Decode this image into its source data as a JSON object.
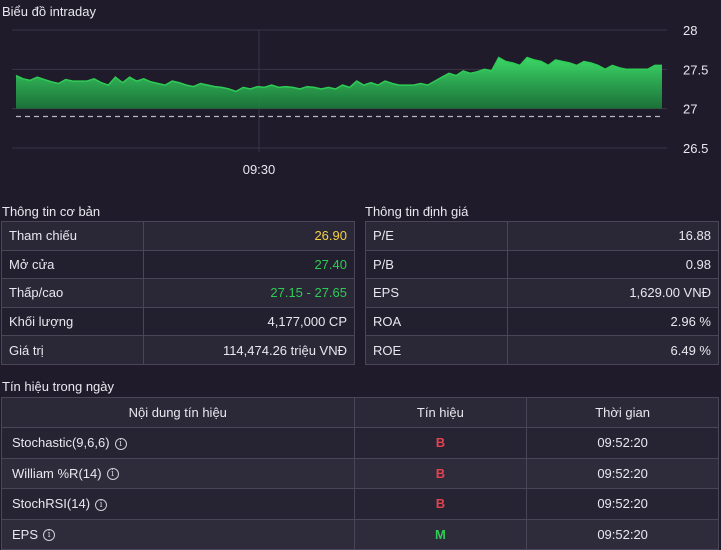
{
  "chart": {
    "title": "Biểu đồ intraday",
    "x_tick": "09:30",
    "y_ticks": [
      "28",
      "27.5",
      "27",
      "26.5"
    ],
    "reference_price": 26.9,
    "fill_color": "#2ecc55",
    "line_color": "#2ecc55",
    "price_series": [
      27.42,
      27.38,
      27.36,
      27.4,
      27.37,
      27.34,
      27.32,
      27.37,
      27.35,
      27.35,
      27.35,
      27.38,
      27.33,
      27.3,
      27.4,
      27.33,
      27.4,
      27.35,
      27.38,
      27.34,
      27.32,
      27.3,
      27.35,
      27.33,
      27.3,
      27.28,
      27.32,
      27.3,
      27.28,
      27.27,
      27.25,
      27.22,
      27.27,
      27.25,
      27.28,
      27.27,
      27.3,
      27.27,
      27.28,
      27.27,
      27.25,
      27.28,
      27.27,
      27.25,
      27.27,
      27.25,
      27.3,
      27.27,
      27.35,
      27.3,
      27.33,
      27.3,
      27.35,
      27.32,
      27.3,
      27.3,
      27.3,
      27.32,
      27.3,
      27.35,
      27.4,
      27.45,
      27.42,
      27.48,
      27.45,
      27.47,
      27.5,
      27.48,
      27.65,
      27.6,
      27.58,
      27.55,
      27.65,
      27.62,
      27.6,
      27.55,
      27.62,
      27.6,
      27.58,
      27.55,
      27.6,
      27.58,
      27.55,
      27.5,
      27.55,
      27.52,
      27.5,
      27.5,
      27.5,
      27.5,
      27.55,
      27.55
    ]
  },
  "basic_info": {
    "title": "Thông tin cơ bản",
    "rows": [
      {
        "label": "Tham chiếu",
        "value": "26.90",
        "color": "yellow"
      },
      {
        "label": "Mở cửa",
        "value": "27.40",
        "color": "green"
      },
      {
        "label": "Thấp/cao",
        "value": "27.15 - 27.65",
        "color": "green"
      },
      {
        "label": "Khối lượng",
        "value": "4,177,000 CP",
        "color": ""
      },
      {
        "label": "Giá trị",
        "value": "114,474.26 triệu VNĐ",
        "color": ""
      }
    ]
  },
  "valuation": {
    "title": "Thông tin định giá",
    "rows": [
      {
        "label": "P/E",
        "value": "16.88"
      },
      {
        "label": "P/B",
        "value": "0.98"
      },
      {
        "label": "EPS",
        "value": "1,629.00 VNĐ"
      },
      {
        "label": "ROA",
        "value": "2.96 %"
      },
      {
        "label": "ROE",
        "value": "6.49 %"
      }
    ]
  },
  "signals": {
    "title": "Tín hiệu trong ngày",
    "headers": [
      "Nội dung tín hiệu",
      "Tín hiệu",
      "Thời gian"
    ],
    "rows": [
      {
        "name": "Stochastic(9,6,6)",
        "signal": "B",
        "signal_color": "red",
        "time": "09:52:20"
      },
      {
        "name": "William %R(14)",
        "signal": "B",
        "signal_color": "red",
        "time": "09:52:20"
      },
      {
        "name": "StochRSI(14)",
        "signal": "B",
        "signal_color": "red",
        "time": "09:52:20"
      },
      {
        "name": "EPS",
        "signal": "M",
        "signal_color": "green",
        "time": "09:52:20"
      }
    ]
  }
}
